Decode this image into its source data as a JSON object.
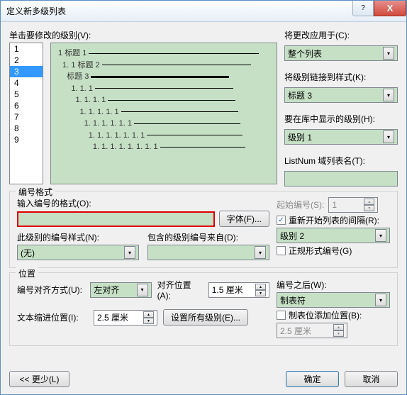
{
  "title": "定义新多级列表",
  "titlebar": {
    "help": "?",
    "close": "X"
  },
  "top": {
    "clickLevelLabel": "单击要修改的级别(V):",
    "levels": [
      "1",
      "2",
      "3",
      "4",
      "5",
      "6",
      "7",
      "8",
      "9"
    ],
    "selectedLevel": "3",
    "preview": {
      "lines": [
        {
          "indent": 0,
          "num": "1",
          "text": "标题 1",
          "rule": 240
        },
        {
          "indent": 1,
          "num": "1. 1",
          "text": "标题 2",
          "rule": 210
        },
        {
          "indent": 2,
          "num": "",
          "text": "标题 3",
          "rule": 195,
          "thick": true
        },
        {
          "indent": 3,
          "num": "1. 1. 1",
          "text": "",
          "rule": 195
        },
        {
          "indent": 4,
          "num": "1. 1. 1. 1",
          "text": "",
          "rule": 180
        },
        {
          "indent": 5,
          "num": "1. 1. 1. 1. 1",
          "text": "",
          "rule": 165
        },
        {
          "indent": 6,
          "num": "1. 1. 1. 1. 1. 1",
          "text": "",
          "rule": 150
        },
        {
          "indent": 7,
          "num": "1. 1. 1. 1. 1. 1. 1",
          "text": "",
          "rule": 135
        },
        {
          "indent": 8,
          "num": "1. 1. 1. 1. 1. 1. 1. 1",
          "text": "",
          "rule": 120
        }
      ]
    },
    "applyChangesLabel": "将更改应用于(C):",
    "applyChangesValue": "整个列表",
    "linkStyleLabel": "将级别链接到样式(K):",
    "linkStyleValue": "标题 3",
    "galleryLevelLabel": "要在库中显示的级别(H):",
    "galleryLevelValue": "级别 1",
    "listNumLabel": "ListNum 域列表名(T):",
    "listNumValue": ""
  },
  "numFormat": {
    "groupTitle": "编号格式",
    "enterFormatLabel": "输入编号的格式(O):",
    "enterFormatValue": "",
    "fontBtn": "字体(F)...",
    "styleLabel": "此级别的编号样式(N):",
    "styleValue": "(无)",
    "includeLabel": "包含的级别编号来自(D):",
    "includeValue": "",
    "startAtLabel": "起始编号(S):",
    "startAtValue": "1",
    "restartLabel": "重新开始列表的间隔(R):",
    "restartChecked": true,
    "restartValue": "级别 2",
    "legalLabel": "正规形式编号(G)",
    "legalChecked": false
  },
  "position": {
    "groupTitle": "位置",
    "alignLabel": "编号对齐方式(U):",
    "alignValue": "左对齐",
    "alignAtLabel": "对齐位置(A):",
    "alignAtValue": "1.5 厘米",
    "indentLabel": "文本缩进位置(I):",
    "indentValue": "2.5 厘米",
    "setAllBtn": "设置所有级别(E)...",
    "followLabel": "编号之后(W):",
    "followValue": "制表符",
    "tabStopLabel": "制表位添加位置(B):",
    "tabStopChecked": false,
    "tabStopValue": "2.5 厘米"
  },
  "footer": {
    "less": "<< 更少(L)",
    "ok": "确定",
    "cancel": "取消"
  }
}
